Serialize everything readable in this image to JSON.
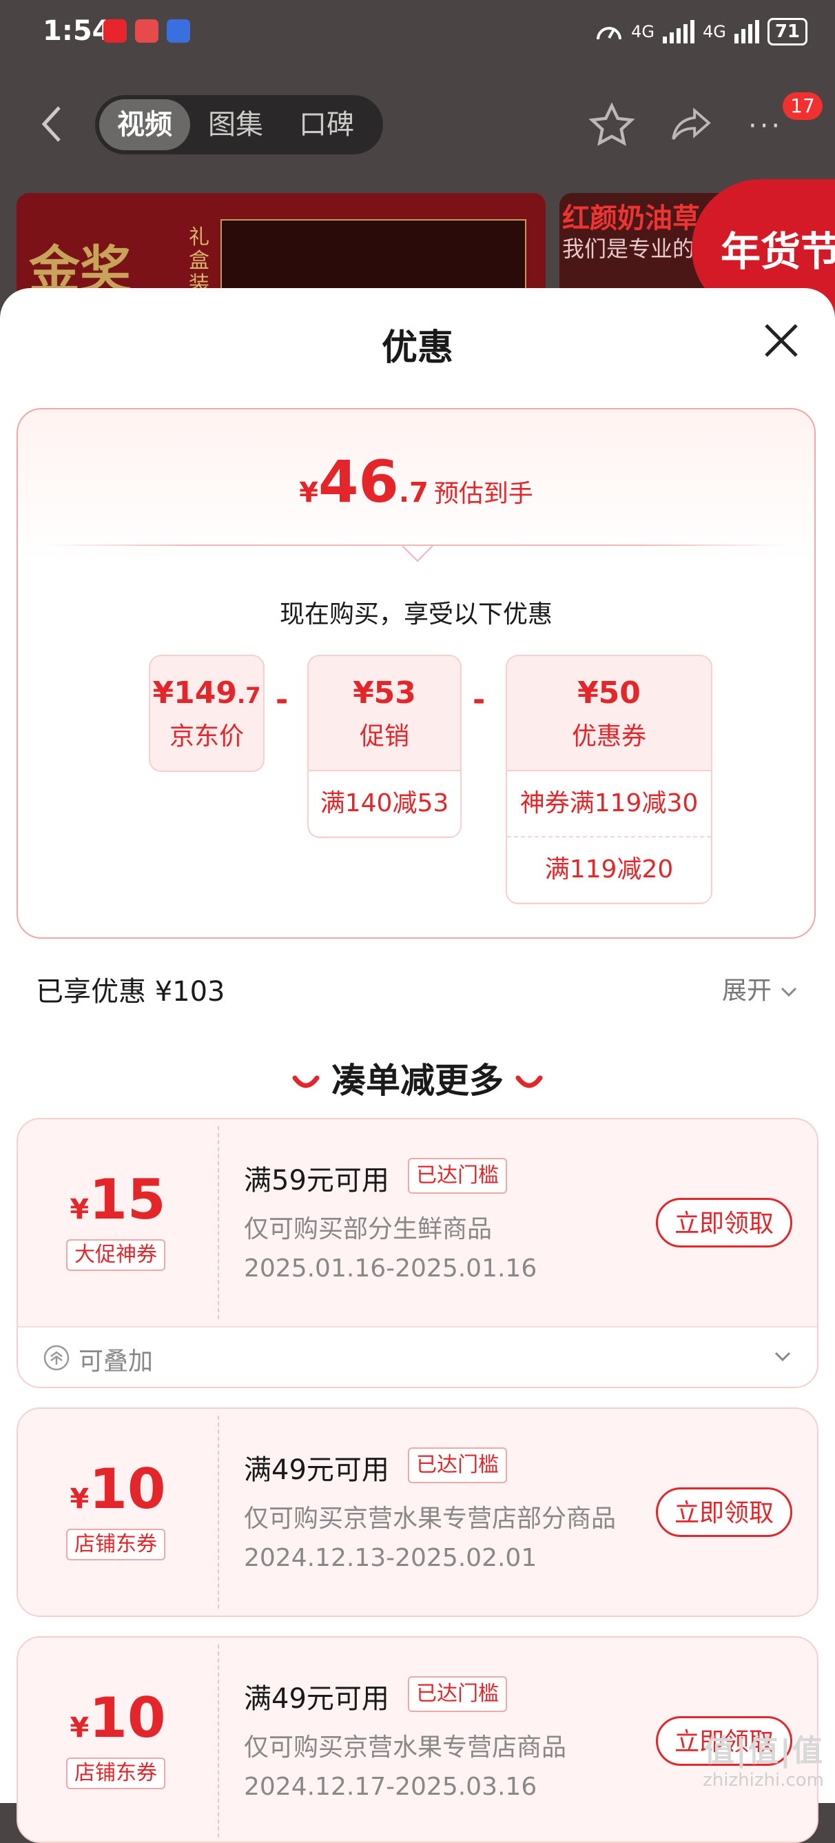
{
  "status_bar": {
    "time": "1:54",
    "signal1": "4G",
    "signal2": "4G",
    "battery": "71"
  },
  "nav": {
    "tabs": [
      "视频",
      "图集",
      "口碑"
    ],
    "active_tab": "视频",
    "message_count": "17"
  },
  "banner": {
    "left_title": "金奖",
    "left_sub": "礼盒装",
    "right_title": "红颜奶油草",
    "right_sub": "我们是专业的",
    "festival": "年货节"
  },
  "sheet": {
    "title": "优惠",
    "estimate": {
      "currency": "¥",
      "integer": "46",
      "decimal": ".7",
      "label": "预估到手"
    },
    "enjoy_text": "现在购买，享受以下优惠",
    "breakdown": {
      "jd_price": {
        "currency": "¥",
        "integer": "149",
        "decimal": ".7",
        "label": "京东价"
      },
      "minus": "-",
      "promotion": {
        "amount": "¥53",
        "label": "促销",
        "rules": [
          "满140减53"
        ]
      },
      "coupon": {
        "amount": "¥50",
        "label": "优惠券",
        "rules": [
          "神券满119减30",
          "满119减20"
        ]
      }
    },
    "enjoyed": "已享优惠 ¥103",
    "expand": "展开",
    "more_title": "凑单减更多",
    "coupons": [
      {
        "currency": "¥",
        "amount": "15",
        "tag": "大促神券",
        "title": "满59元可用",
        "reached": "已达门槛",
        "desc": "仅可购买部分生鲜商品",
        "date": "2025.01.16-2025.01.16",
        "button": "立即领取",
        "stack": "可叠加"
      },
      {
        "currency": "¥",
        "amount": "10",
        "tag": "店铺东券",
        "title": "满49元可用",
        "reached": "已达门槛",
        "desc": "仅可购买京营水果专营店部分商品",
        "date": "2024.12.13-2025.02.01",
        "button": "立即领取"
      },
      {
        "currency": "¥",
        "amount": "10",
        "tag": "店铺东券",
        "title": "满49元可用",
        "reached": "已达门槛",
        "desc": "仅可购买京营水果专营店商品",
        "date": "2024.12.17-2025.03.16",
        "button": "立即领取"
      }
    ]
  },
  "watermark": {
    "logo": "值|值|值",
    "site": "zhizhizhi.com"
  },
  "colors": {
    "accent": "#e4262a",
    "card_border": "#f0a7a7",
    "card_bg": "#fff4f3"
  },
  "icons": [
    "back-icon",
    "star-icon",
    "share-icon",
    "more-icon",
    "close-icon",
    "chevron-down-icon",
    "stack-icon"
  ]
}
